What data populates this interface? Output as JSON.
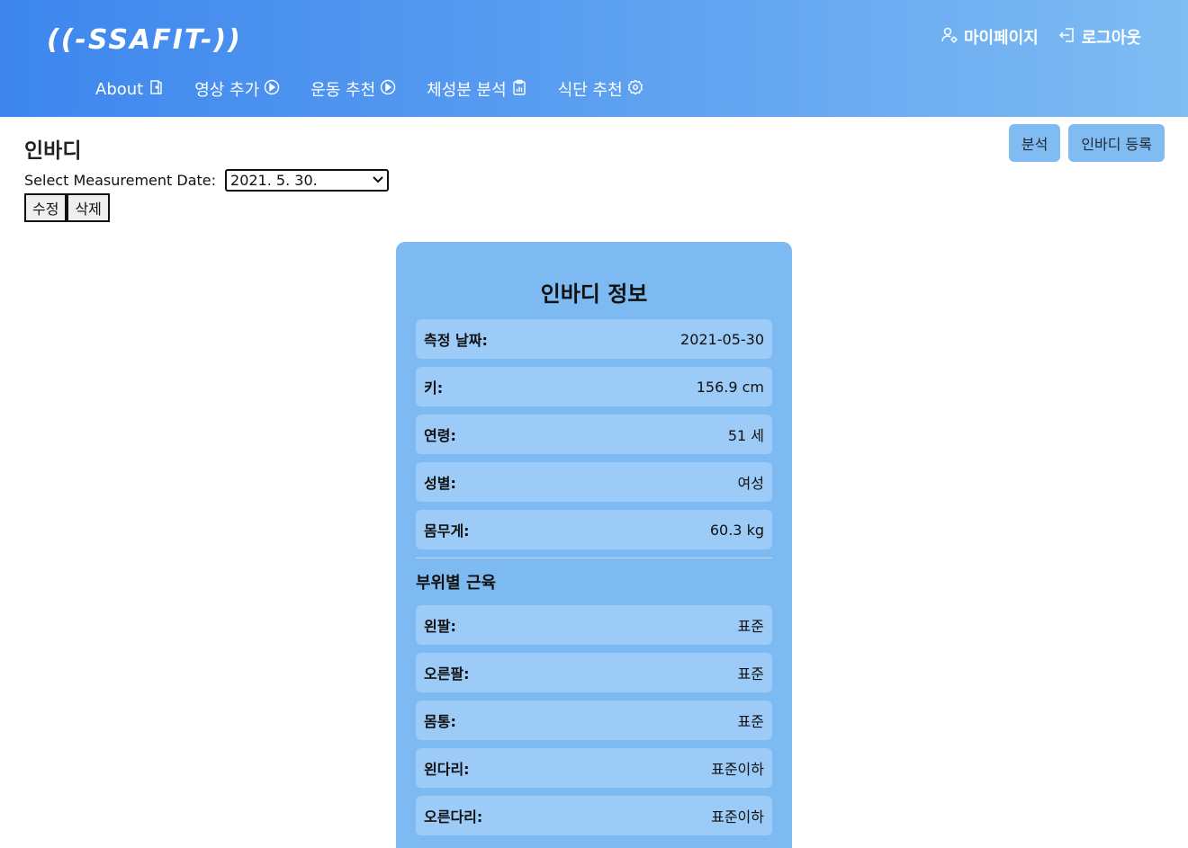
{
  "header": {
    "logo": "((-SSAFIT-))",
    "top_links": {
      "mypage": "마이페이지",
      "logout": "로그아웃"
    },
    "nav": [
      {
        "label": "About",
        "icon": "door-icon"
      },
      {
        "label": "영상 추가",
        "icon": "play-circle-icon"
      },
      {
        "label": "운동 추천",
        "icon": "play-circle-icon"
      },
      {
        "label": "체성분 분석",
        "icon": "clipboard-chart-icon"
      },
      {
        "label": "식단 추천",
        "icon": "gear-badge-icon"
      }
    ]
  },
  "page": {
    "title": "인바디",
    "actions": {
      "analyze": "분석",
      "register": "인바디 등록"
    },
    "date_label": "Select Measurement Date:",
    "date_selected": "2021. 5. 30.",
    "edit": "수정",
    "delete": "삭제"
  },
  "card": {
    "title": "인바디 정보",
    "info": [
      {
        "label": "측정 날짜:",
        "value": "2021-05-30"
      },
      {
        "label": "키:",
        "value": "156.9 cm"
      },
      {
        "label": "연령:",
        "value": "51 세"
      },
      {
        "label": "성별:",
        "value": "여성"
      },
      {
        "label": "몸무게:",
        "value": "60.3 kg"
      }
    ],
    "muscle_title": "부위별 근육",
    "muscle": [
      {
        "label": "왼팔:",
        "value": "표준"
      },
      {
        "label": "오른팔:",
        "value": "표준"
      },
      {
        "label": "몸통:",
        "value": "표준"
      },
      {
        "label": "왼다리:",
        "value": "표준이하"
      },
      {
        "label": "오른다리:",
        "value": "표준이하"
      }
    ]
  }
}
